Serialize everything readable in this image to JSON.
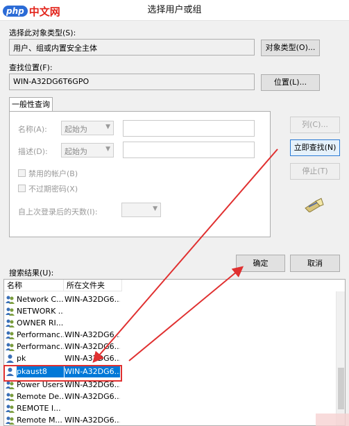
{
  "window": {
    "title": "选择用户或组"
  },
  "watermark": {
    "logo_badge": "php",
    "logo_text": "中文网"
  },
  "object_type": {
    "label": "选择此对象类型(S):",
    "value": "用户、组或内置安全主体",
    "button": "对象类型(O)..."
  },
  "location": {
    "label": "查找位置(F):",
    "value": "WIN-A32DG6T6GPO",
    "button": "位置(L)..."
  },
  "general_query": {
    "tab": "一般性查询",
    "name_label": "名称(A):",
    "name_mode": "起始为",
    "desc_label": "描述(D):",
    "desc_mode": "起始为",
    "disabled_accounts": "禁用的帐户(B)",
    "no_expire": "不过期密码(X)",
    "days_label": "自上次登录后的天数(I):"
  },
  "side_buttons": {
    "columns": "列(C)...",
    "find_now": "立即查找(N)",
    "stop": "停止(T)"
  },
  "dialog_buttons": {
    "ok": "确定",
    "cancel": "取消"
  },
  "results": {
    "label": "搜索结果(U):",
    "columns": [
      "名称",
      "所在文件夹"
    ],
    "rows": [
      {
        "name": "Network C...",
        "folder": "WIN-A32DG6..."
      },
      {
        "name": "NETWORK ...",
        "folder": ""
      },
      {
        "name": "OWNER RI...",
        "folder": ""
      },
      {
        "name": "Performanc...",
        "folder": "WIN-A32DG6..."
      },
      {
        "name": "Performanc...",
        "folder": "WIN-A32DG6..."
      },
      {
        "name": "pk",
        "folder": "WIN-A32DG6..."
      },
      {
        "name": "pkaust8",
        "folder": "WIN-A32DG6...",
        "selected": true
      },
      {
        "name": "Power Users",
        "folder": "WIN-A32DG6..."
      },
      {
        "name": "Remote De...",
        "folder": "WIN-A32DG6..."
      },
      {
        "name": "REMOTE I...",
        "folder": ""
      },
      {
        "name": "Remote M...",
        "folder": "WIN-A32DG6..."
      }
    ]
  },
  "colors": {
    "annotation": "#e03030",
    "selection": "#0078d7",
    "logo_red": "#e2231a",
    "logo_blue": "#2b6bd6"
  }
}
